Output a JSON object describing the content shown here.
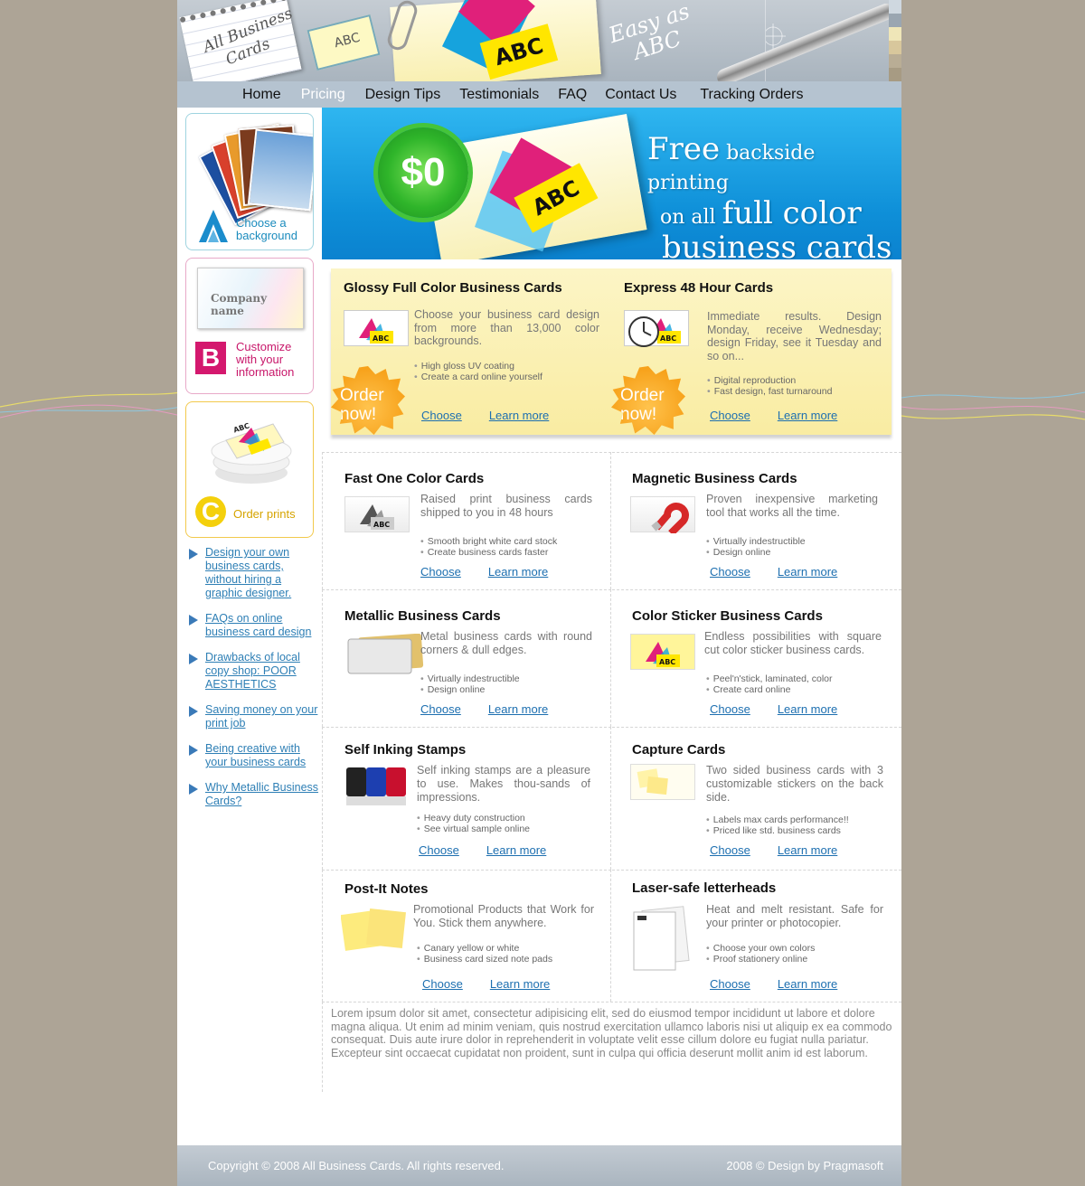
{
  "header": {
    "notepad_line1": "All Business",
    "notepad_line2": "Cards",
    "sketch_card_text": "ABC",
    "card_text": "ABC",
    "slogan_line1": "Easy as",
    "slogan_line2": "ABC"
  },
  "nav": {
    "items": [
      "Home",
      "Pricing",
      "Design Tips",
      "Testimonials",
      "FAQ",
      "Contact Us",
      "Tracking Orders"
    ],
    "active": "Pricing"
  },
  "sidebar": {
    "box_a": {
      "letter": "A",
      "label": "Choose a background"
    },
    "box_b": {
      "letter": "B",
      "label": "Customize with your information",
      "card_company": "Company name"
    },
    "box_c": {
      "letter": "C",
      "label": "Order prints",
      "card_text": "ABC"
    },
    "links": [
      "Design your own business cards, without hiring a graphic designer.",
      "FAQs on online business card design",
      "Drawbacks of local copy shop: POOR AESTHETICS",
      "Saving money on your print job",
      "Being creative with your business cards",
      "Why Metallic Business Cards?"
    ]
  },
  "banner": {
    "seal_text": "$0",
    "card_text": "ABC",
    "line1_big": "Free",
    "line1_small": " backside printing",
    "line2_small": "on all ",
    "line2_big": "full color",
    "line3_big": "business cards"
  },
  "featured": [
    {
      "title": "Glossy Full Color Business Cards",
      "desc": "Choose your business card design from more than 13,000 color backgrounds.",
      "bullets": [
        "High gloss UV coating",
        "Create a card online yourself"
      ],
      "badge": "Order now!",
      "choose": "Choose",
      "learn": "Learn more"
    },
    {
      "title": "Express 48 Hour Cards",
      "desc": "Immediate results. Design Monday, receive Wednesday; design Friday, see it Tuesday and so on...",
      "bullets": [
        "Digital reproduction",
        "Fast design, fast turnaround"
      ],
      "badge": "Order now!",
      "choose": "Choose",
      "learn": "Learn more"
    }
  ],
  "products": [
    {
      "title": "Fast One Color Cards",
      "desc": "Raised print business cards shipped to you in 48 hours",
      "bullets": [
        "Smooth bright white card stock",
        "Create business cards faster"
      ],
      "choose": "Choose",
      "learn": "Learn more"
    },
    {
      "title": "Magnetic Business Cards",
      "desc": "Proven inexpensive marketing tool that works all the time.",
      "bullets": [
        "Virtually indestructible",
        "Design online"
      ],
      "choose": "Choose",
      "learn": "Learn more"
    },
    {
      "title": "Metallic Business Cards",
      "desc": "Metal business cards with round corners & dull edges.",
      "bullets": [
        "Virtually indestructible",
        "Design online"
      ],
      "choose": "Choose",
      "learn": "Learn more"
    },
    {
      "title": "Color Sticker Business Cards",
      "desc": "Endless possibilities with square cut color sticker business cards.",
      "bullets": [
        "Peel'n'stick, laminated, color",
        "Create card online"
      ],
      "choose": "Choose",
      "learn": "Learn more"
    },
    {
      "title": "Self Inking Stamps",
      "desc": "Self inking stamps are a pleasure to use. Makes thou-sands of impressions.",
      "bullets": [
        "Heavy duty construction",
        "See virtual sample online"
      ],
      "choose": "Choose",
      "learn": "Learn more"
    },
    {
      "title": "Capture Cards",
      "desc": "Two sided business cards with 3 customizable stickers on the back side.",
      "bullets": [
        "Labels max cards performance!!",
        "Priced like std. business cards"
      ],
      "choose": "Choose",
      "learn": "Learn more"
    },
    {
      "title": "Post-It Notes",
      "desc": "Promotional Products that Work for You. Stick them anywhere.",
      "bullets": [
        "Canary yellow or white",
        "Business card sized note pads"
      ],
      "choose": "Choose",
      "learn": "Learn more"
    },
    {
      "title": "Laser-safe letterheads",
      "desc": "Heat and melt resistant. Safe for your printer or photocopier.",
      "bullets": [
        "Choose your own colors",
        "Proof stationery online"
      ],
      "choose": "Choose",
      "learn": "Learn more"
    }
  ],
  "lorem": "Lorem ipsum dolor sit amet, consectetur adipisicing elit, sed do eiusmod tempor incididunt ut labore et dolore magna aliqua. Ut enim ad minim veniam, quis nostrud exercitation ullamco laboris nisi ut aliquip ex ea commodo consequat. Duis aute irure dolor in reprehenderit in voluptate velit esse cillum dolore eu fugiat nulla pariatur. Excepteur sint occaecat cupidatat non proident, sunt in culpa qui officia deserunt mollit anim id est laborum.",
  "footer": {
    "copyright": "Copyright © 2008 All Business Cards. All rights reserved.",
    "design": "2008 © Design by Pragmasoft"
  },
  "colors": {
    "background": "#ada496",
    "nav_bar": "#b5c3d0",
    "banner_blue": "#0e8fd8",
    "link_blue": "#1d6fb0",
    "featured_yellow": "#f9eca2",
    "badge_orange": "#f7a21b",
    "magenta": "#e0207a",
    "card_yellow": "#ffe600"
  }
}
